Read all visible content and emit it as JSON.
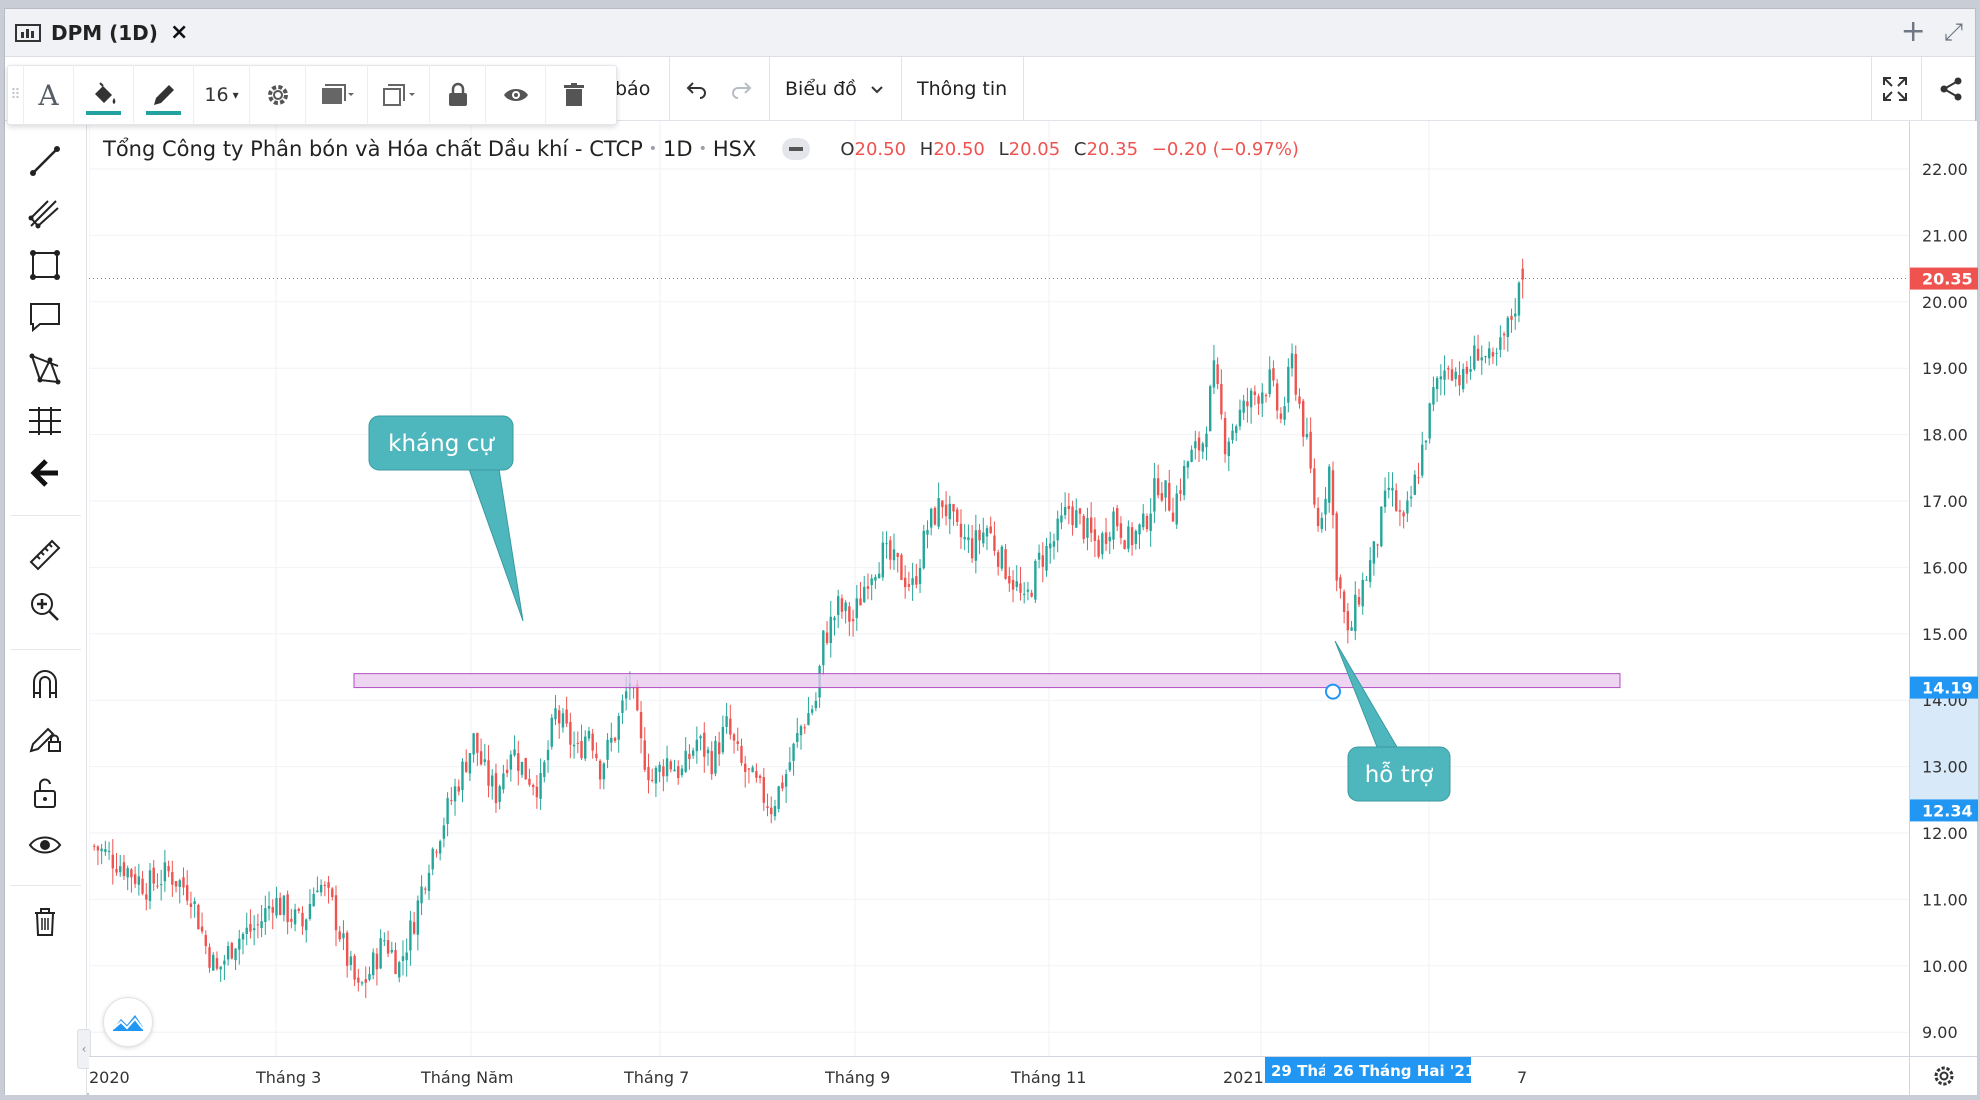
{
  "window": {
    "tab_title": "DPM (1D)",
    "close_symbol": "×",
    "add_symbol": "+",
    "expand_symbol": "⤢"
  },
  "floating_toolbar": {
    "font_size": "16",
    "dropdown_arrow": "▾"
  },
  "toolbar": {
    "alert_label": "báo",
    "chart_menu_label": "Biểu đồ",
    "info_label": "Thông tin"
  },
  "legend": {
    "symbol_name": "Tổng Công ty Phân bón và Hóa chất Dầu khí - CTCP",
    "interval": "1D",
    "exchange": "HSX",
    "open_key": "O",
    "open": "20.50",
    "high_key": "H",
    "high": "20.50",
    "low_key": "L",
    "low": "20.05",
    "close_key": "C",
    "close": "20.35",
    "change": "−0.20 (−0.97%)"
  },
  "annotations": {
    "resistance_label": "kháng cự",
    "support_label": "hỗ trợ"
  },
  "colors": {
    "up": "#26a69a",
    "down": "#ef5350",
    "teal_callout": "#4eb7bd",
    "zone_fill": "#e8c8ef",
    "zone_border": "#b34fc1",
    "price_label_blue": "#2196f3"
  },
  "price_axis": {
    "ticks": [
      "22.00",
      "21.00",
      "20.00",
      "19.00",
      "18.00",
      "17.00",
      "16.00",
      "15.00",
      "14.00",
      "13.00",
      "12.00",
      "11.00",
      "10.00",
      "9.00"
    ],
    "last_price_label": "20.35",
    "zone_top_label": "14.19",
    "zone_bottom_label": "12.34"
  },
  "time_axis": {
    "labels": [
      "2020",
      "Tháng 3",
      "Tháng Năm",
      "Tháng 7",
      "Tháng 9",
      "Tháng 11",
      "2021",
      "7"
    ],
    "crosshair_label_1": "29 Thá",
    "crosshair_label_2": "26 Tháng Hai '21"
  },
  "chart_data": {
    "type": "candlestick",
    "symbol": "DPM",
    "interval": "1D",
    "ylim": [
      8.5,
      22.2
    ],
    "last_price": 20.35,
    "support_resistance_zone": [
      14.19,
      14.4
    ],
    "highlighted_range": [
      12.34,
      14.19
    ],
    "series": [
      {
        "name": "price_path",
        "values": [
          [
            0,
            11.8
          ],
          [
            8,
            11.5
          ],
          [
            14,
            11.2
          ],
          [
            20,
            11.4
          ],
          [
            26,
            11.1
          ],
          [
            30,
            10.3
          ],
          [
            33,
            9.9
          ],
          [
            38,
            10.4
          ],
          [
            44,
            10.6
          ],
          [
            48,
            11.0
          ],
          [
            52,
            10.8
          ],
          [
            56,
            10.6
          ],
          [
            60,
            11.3
          ],
          [
            64,
            10.9
          ],
          [
            68,
            10.1
          ],
          [
            71,
            9.6
          ],
          [
            74,
            9.9
          ],
          [
            78,
            10.4
          ],
          [
            82,
            10.0
          ],
          [
            86,
            10.7
          ],
          [
            90,
            11.6
          ],
          [
            94,
            12.2
          ],
          [
            98,
            12.8
          ],
          [
            102,
            13.4
          ],
          [
            105,
            12.9
          ],
          [
            108,
            12.6
          ],
          [
            112,
            13.3
          ],
          [
            116,
            12.9
          ],
          [
            120,
            12.7
          ],
          [
            124,
            13.8
          ],
          [
            127,
            13.5
          ],
          [
            130,
            13.2
          ],
          [
            133,
            13.6
          ],
          [
            136,
            13.0
          ],
          [
            140,
            13.5
          ],
          [
            144,
            14.3
          ],
          [
            147,
            13.3
          ],
          [
            150,
            12.8
          ],
          [
            154,
            13.1
          ],
          [
            158,
            12.9
          ],
          [
            162,
            13.4
          ],
          [
            166,
            13.1
          ],
          [
            170,
            13.6
          ],
          [
            174,
            13.0
          ],
          [
            178,
            12.7
          ],
          [
            182,
            12.4
          ],
          [
            186,
            12.9
          ],
          [
            190,
            13.6
          ],
          [
            194,
            14.0
          ],
          [
            196,
            14.9
          ],
          [
            200,
            15.4
          ],
          [
            204,
            15.2
          ],
          [
            208,
            15.9
          ],
          [
            212,
            16.2
          ],
          [
            216,
            16.0
          ],
          [
            220,
            15.7
          ],
          [
            224,
            16.6
          ],
          [
            228,
            17.0
          ],
          [
            232,
            16.5
          ],
          [
            236,
            16.3
          ],
          [
            240,
            16.6
          ],
          [
            244,
            16.1
          ],
          [
            248,
            15.7
          ],
          [
            250,
            15.4
          ],
          [
            254,
            16.1
          ],
          [
            258,
            16.4
          ],
          [
            262,
            16.9
          ],
          [
            266,
            16.6
          ],
          [
            270,
            16.3
          ],
          [
            274,
            16.8
          ],
          [
            278,
            16.4
          ],
          [
            282,
            16.6
          ],
          [
            286,
            17.3
          ],
          [
            290,
            16.9
          ],
          [
            294,
            17.6
          ],
          [
            298,
            17.9
          ],
          [
            301,
            18.9
          ],
          [
            304,
            17.9
          ],
          [
            308,
            18.3
          ],
          [
            312,
            18.6
          ],
          [
            316,
            18.8
          ],
          [
            319,
            18.2
          ],
          [
            322,
            19.1
          ],
          [
            326,
            17.8
          ],
          [
            329,
            16.6
          ],
          [
            332,
            17.5
          ],
          [
            334,
            16.0
          ],
          [
            337,
            14.9
          ],
          [
            340,
            15.6
          ],
          [
            344,
            16.2
          ],
          [
            348,
            17.2
          ],
          [
            352,
            16.6
          ],
          [
            356,
            17.5
          ],
          [
            360,
            18.6
          ],
          [
            364,
            19.1
          ],
          [
            368,
            18.8
          ],
          [
            372,
            19.3
          ],
          [
            376,
            19.0
          ],
          [
            380,
            19.6
          ],
          [
            384,
            20.35
          ]
        ]
      }
    ]
  }
}
